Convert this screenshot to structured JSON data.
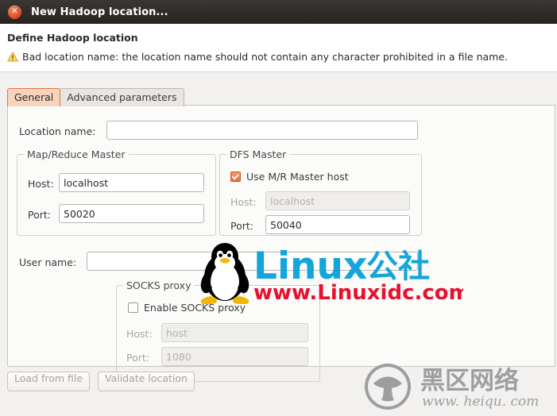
{
  "window": {
    "title": "New Hadoop location...",
    "close_icon": "close-icon"
  },
  "header": {
    "title": "Define Hadoop location",
    "warning_icon": "warning-triangle-icon",
    "warning_message": "Bad location name: the location name should not contain any character prohibited in a file name."
  },
  "tabs": [
    {
      "label": "General",
      "selected": true
    },
    {
      "label": "Advanced parameters",
      "selected": false
    }
  ],
  "form": {
    "location_name": {
      "label": "Location name:",
      "value": "",
      "placeholder": ""
    },
    "mapreduce_master": {
      "legend": "Map/Reduce Master",
      "host": {
        "label": "Host:",
        "value": "localhost",
        "disabled": false
      },
      "port": {
        "label": "Port:",
        "value": "50020",
        "disabled": false
      }
    },
    "dfs_master": {
      "legend": "DFS Master",
      "use_mr_master_host": {
        "label": "Use M/R Master host",
        "checked": true
      },
      "host": {
        "label": "Host:",
        "value": "",
        "placeholder": "localhost",
        "disabled": true
      },
      "port": {
        "label": "Port:",
        "value": "50040",
        "disabled": false
      }
    },
    "user_name": {
      "label": "User name:",
      "value": "",
      "placeholder": ""
    },
    "socks_proxy": {
      "legend": "SOCKS proxy",
      "enable": {
        "label": "Enable SOCKS proxy",
        "checked": false
      },
      "host": {
        "label": "Host:",
        "value": "",
        "placeholder": "host",
        "disabled": true
      },
      "port": {
        "label": "Port:",
        "value": "",
        "placeholder": "1080",
        "disabled": true
      }
    }
  },
  "buttons": {
    "load_from_file": "Load from file",
    "validate_location": "Validate location"
  },
  "watermarks": {
    "linux": {
      "brand": "Linux",
      "brand_cn": "公社",
      "url": "www.Linuxidc.com",
      "mascot_icon": "tux-penguin-icon",
      "brand_color": "#14a5dc",
      "url_color": "#e8112d"
    },
    "heiqu": {
      "logo_icon": "mushroom-circle-icon",
      "brand_cn": "黑区网络",
      "url": "www. heiqu. com",
      "color": "#9e9e9e"
    }
  },
  "colors": {
    "titlebar": "#2f2b28",
    "accent_orange": "#e4703c",
    "panel_bg": "#fbfbfa",
    "window_bg": "#f2f1f0"
  }
}
